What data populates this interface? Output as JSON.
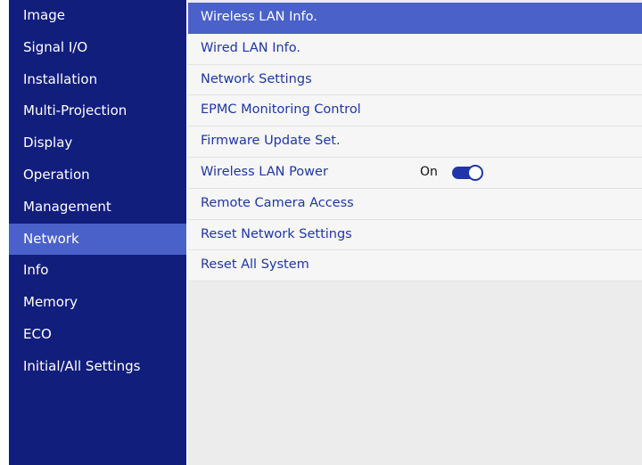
{
  "sidebar": {
    "items": [
      {
        "label": "Image"
      },
      {
        "label": "Signal I/O"
      },
      {
        "label": "Installation"
      },
      {
        "label": "Multi-Projection"
      },
      {
        "label": "Display"
      },
      {
        "label": "Operation"
      },
      {
        "label": "Management"
      },
      {
        "label": "Network",
        "active": true
      },
      {
        "label": "Info"
      },
      {
        "label": "Memory"
      },
      {
        "label": "ECO"
      },
      {
        "label": "Initial/All Settings"
      }
    ]
  },
  "network_menu": {
    "items": [
      {
        "label": "Wireless LAN Info.",
        "selected": true
      },
      {
        "label": "Wired LAN Info."
      },
      {
        "label": "Network Settings"
      },
      {
        "label": "EPMC Monitoring Control"
      },
      {
        "label": "Firmware Update Set."
      },
      {
        "label": "Wireless LAN Power",
        "value": "On",
        "toggle_on": true
      },
      {
        "label": "Remote Camera Access"
      },
      {
        "label": "Reset Network Settings"
      },
      {
        "label": "Reset All System"
      }
    ]
  },
  "colors": {
    "sidebar_bg": "#121e7c",
    "highlight": "#4a61c9",
    "menu_text": "#1f37a6",
    "panel_bg": "#ececec",
    "row_bg": "#f6f6f6",
    "toggle": "#2035a8"
  }
}
